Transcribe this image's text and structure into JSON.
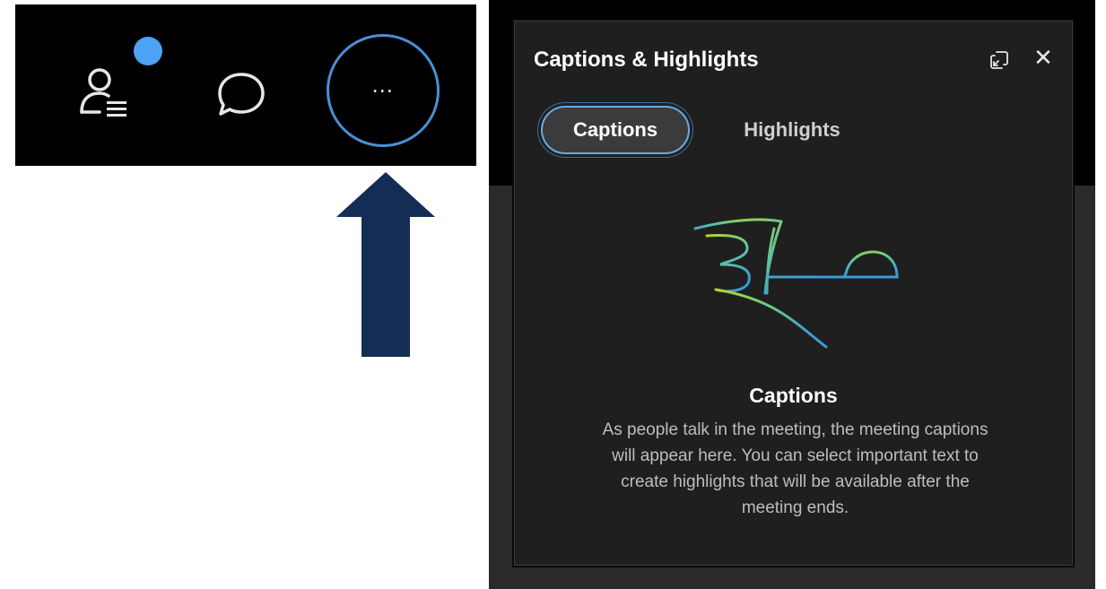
{
  "toolbar": {
    "more_label": "⋯",
    "icons": [
      "people-list-icon",
      "chat-icon",
      "more-options-icon"
    ],
    "notification_color": "#4ea3f5"
  },
  "arrow_color": "#142d55",
  "panel": {
    "title": "Captions & Highlights",
    "close_label": "✕",
    "tabs": [
      {
        "label": "Captions",
        "active": true
      },
      {
        "label": "Highlights",
        "active": false
      }
    ],
    "empty_state": {
      "title": "Captions",
      "text": "As people talk in the meeting, the meeting captions will appear here. You can select important text to create highlights that will be available after the meeting ends."
    }
  }
}
